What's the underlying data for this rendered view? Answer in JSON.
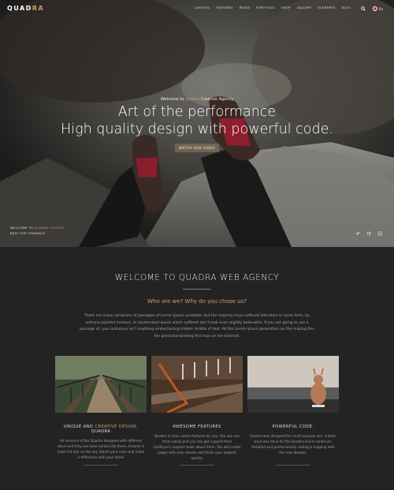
{
  "nav": {
    "logo_main": "QUAD",
    "logo_accent": "RA",
    "menu": [
      "LAYOUTS",
      "FEATURES",
      "PAGES",
      "PORTFOLIO",
      "SHOP",
      "GALLERY",
      "ELEMENTS",
      "BLOG"
    ],
    "lang": "En",
    "icons": {
      "search": "search-icon",
      "flag": "uk-flag-icon"
    }
  },
  "hero": {
    "welcome_prefix": "Welcome to",
    "welcome_brand": "Quadra",
    "welcome_suffix": "Creative Agency",
    "title_line1": "Art of the performance",
    "title_line2": "High quality design with powerful code.",
    "button": "WATCH OUR VIDEO",
    "corner_prefix": "WELCOME TO",
    "corner_accent": "QUADRA CHOOSE",
    "corner_line2": "BEST FOR YOURSELF",
    "social_icons": [
      "twitter-icon",
      "pinterest-icon",
      "instagram-icon"
    ]
  },
  "about": {
    "title": "WELCOME TO QUADRA WEB AGENCY",
    "subtitle": "Who are we? Why do you chose us?",
    "paragraph": "There are many variations of passages of Lorem Ipsum available, but the majority have suffered alteration in some form, by antrana injected humour, or randomised words which suffered don't look even slightly believable. If you are going to use a passage of, you contumue isn't anything embarrassing hidden middle of text. All the Lorem Ipsum generators on the making this the generatorstralling first true on the Internet."
  },
  "features": [
    {
      "title_prefix": "UNIQUE AND",
      "title_accent": "CREATIVE DESIGN,",
      "title_suffix": "QUADRA",
      "desc": "All versions of the Quadra designed with different ideas and they are have names like them. Antares is most red star on the sky. Select your color and make a difference with your style!"
    },
    {
      "title_prefix": "AWESOME FEATURES",
      "title_accent": "",
      "title_suffix": "",
      "desc": "Quadra is have useful features for you. You can use them easily and you can get support from GoldEyes's support team about them. You will create pages with only classes and finish your website quickly."
    },
    {
      "title_prefix": "POWERFUL CODE.",
      "title_accent": "",
      "title_suffix": "",
      "desc": "Quadra was designed for multi-purpose use. A team work was done for the Quadra and it continues. Detailed and professionally coding is ongoing with the new designs."
    }
  ],
  "colors": {
    "accent": "#c9a064",
    "background": "#232323"
  }
}
